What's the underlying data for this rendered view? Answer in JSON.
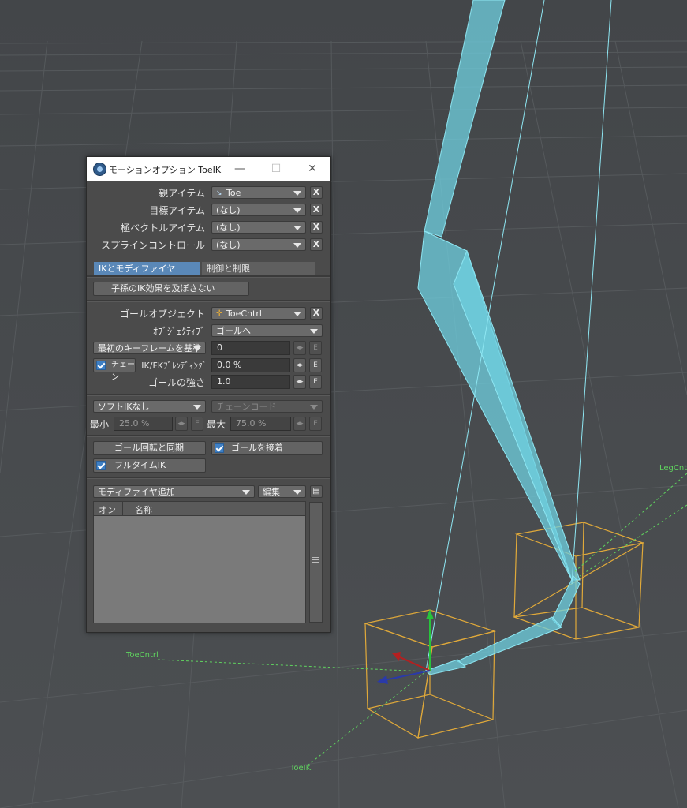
{
  "window": {
    "title": "モーションオプション ToeIK"
  },
  "rows": {
    "parent": {
      "label": "親アイテム",
      "value": "Toe"
    },
    "target": {
      "label": "目標アイテム",
      "value": "(なし)"
    },
    "pole": {
      "label": "極ベクトルアイテム",
      "value": "(なし)"
    },
    "spline": {
      "label": "スプラインコントロール",
      "value": "(なし)"
    }
  },
  "tabs": [
    "IKとモディファイヤ",
    "制御と制限"
  ],
  "child_ik": {
    "label": "子孫のIK効果を及ぼさない"
  },
  "goal": {
    "object_label": "ゴールオブジェクト",
    "object_value": "ToeCntrl",
    "objective_label": "ｵﾌﾞｼﾞｪｸﾃｨﾌﾞ",
    "objective_value": "ゴールへ",
    "keyframe_value": "最初のキーフレームを基準",
    "keyframe_field": "0",
    "chain_label": "チェーン",
    "blend_label": "IK/FKﾌﾞﾚﾝﾃﾞｨﾝｸﾞ",
    "blend_value": "0.0 %",
    "strength_label": "ゴールの強さ",
    "strength_value": "1.0"
  },
  "soft": {
    "mode": "ソフトIKなし",
    "chain": "チェーンコード",
    "min_label": "最小",
    "min_value": "25.0 %",
    "max_label": "最大",
    "max_value": "75.0 %"
  },
  "options": {
    "sync_rotation": "ゴール回転と同期",
    "stick_goal": "ゴールを接着",
    "fulltime_ik": "フルタイムIK"
  },
  "modifiers": {
    "add": "モディファイヤ追加",
    "edit": "編集",
    "col_on": "オン",
    "col_name": "名称"
  },
  "buttons": {
    "x": "X",
    "e": "E",
    "env": "◂▸"
  },
  "viewport": {
    "label_toecntrl": "ToeCntrl",
    "label_toeik": "ToeIK",
    "label_legcntrl": "LegCntrl"
  },
  "colors": {
    "accent": "#5a88b8",
    "bone": "#6fd0e0",
    "null_green": "#5fd35f",
    "cage": "#e0a93a"
  }
}
